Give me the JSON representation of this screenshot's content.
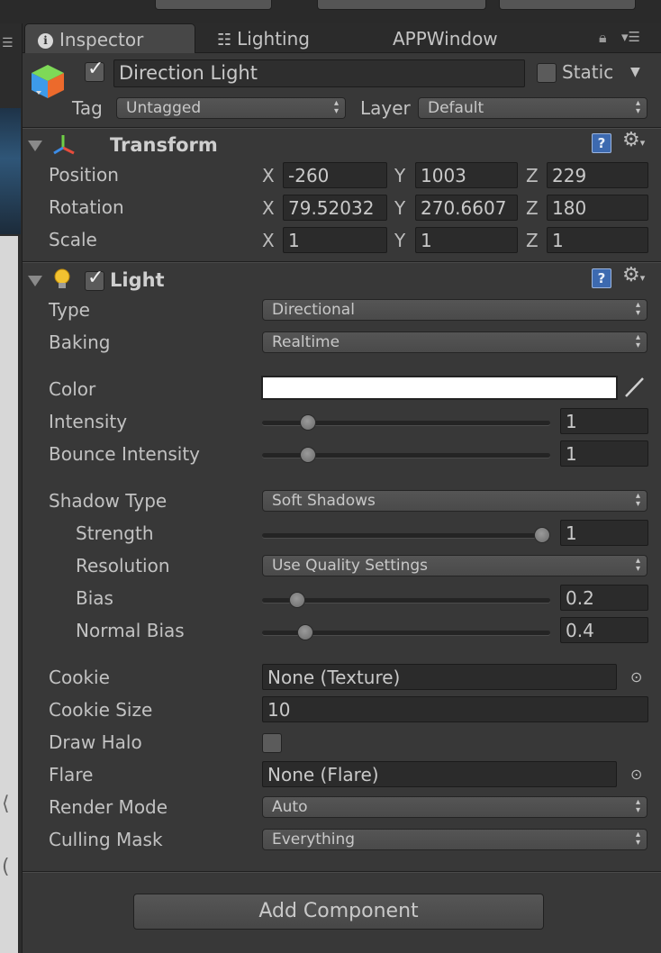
{
  "tabs": [
    {
      "label": "Inspector",
      "active": true,
      "icon": "info-icon"
    },
    {
      "label": "Lighting",
      "active": false,
      "icon": "sliders-icon"
    },
    {
      "label": "APPWindow",
      "active": false
    }
  ],
  "header": {
    "name": "Direction Light",
    "static_label": "Static",
    "tag_label": "Tag",
    "tag_value": "Untagged",
    "layer_label": "Layer",
    "layer_value": "Default"
  },
  "transform": {
    "title": "Transform",
    "rows": [
      {
        "label": "Position",
        "x": "-260",
        "y": "1003",
        "z": "229"
      },
      {
        "label": "Rotation",
        "x": "79.52032",
        "y": "270.6607",
        "z": "180"
      },
      {
        "label": "Scale",
        "x": "1",
        "y": "1",
        "z": "1"
      }
    ],
    "axis": {
      "x": "X",
      "y": "Y",
      "z": "Z"
    }
  },
  "light": {
    "title": "Light",
    "type_label": "Type",
    "type_value": "Directional",
    "baking_label": "Baking",
    "baking_value": "Realtime",
    "color_label": "Color",
    "color_value": "#ffffff",
    "intensity_label": "Intensity",
    "intensity_value": "1",
    "intensity_level": 0.14,
    "bounce_label": "Bounce Intensity",
    "bounce_value": "1",
    "bounce_level": 0.14,
    "shadow_type_label": "Shadow Type",
    "shadow_type_value": "Soft Shadows",
    "strength_label": "Strength",
    "strength_value": "1",
    "strength_level": 1.0,
    "resolution_label": "Resolution",
    "resolution_value": "Use Quality Settings",
    "bias_label": "Bias",
    "bias_value": "0.2",
    "bias_level": 0.1,
    "normal_bias_label": "Normal Bias",
    "normal_bias_value": "0.4",
    "normal_bias_level": 0.13,
    "cookie_label": "Cookie",
    "cookie_value": "None (Texture)",
    "cookie_size_label": "Cookie Size",
    "cookie_size_value": "10",
    "draw_halo_label": "Draw Halo",
    "flare_label": "Flare",
    "flare_value": "None (Flare)",
    "render_mode_label": "Render Mode",
    "render_mode_value": "Auto",
    "culling_mask_label": "Culling Mask",
    "culling_mask_value": "Everything"
  },
  "add_component_label": "Add Component",
  "colors": {
    "panel": "#383838",
    "tabbar": "#2b2b2b",
    "field": "#2b2b2b",
    "help": "#3d6ab0"
  }
}
